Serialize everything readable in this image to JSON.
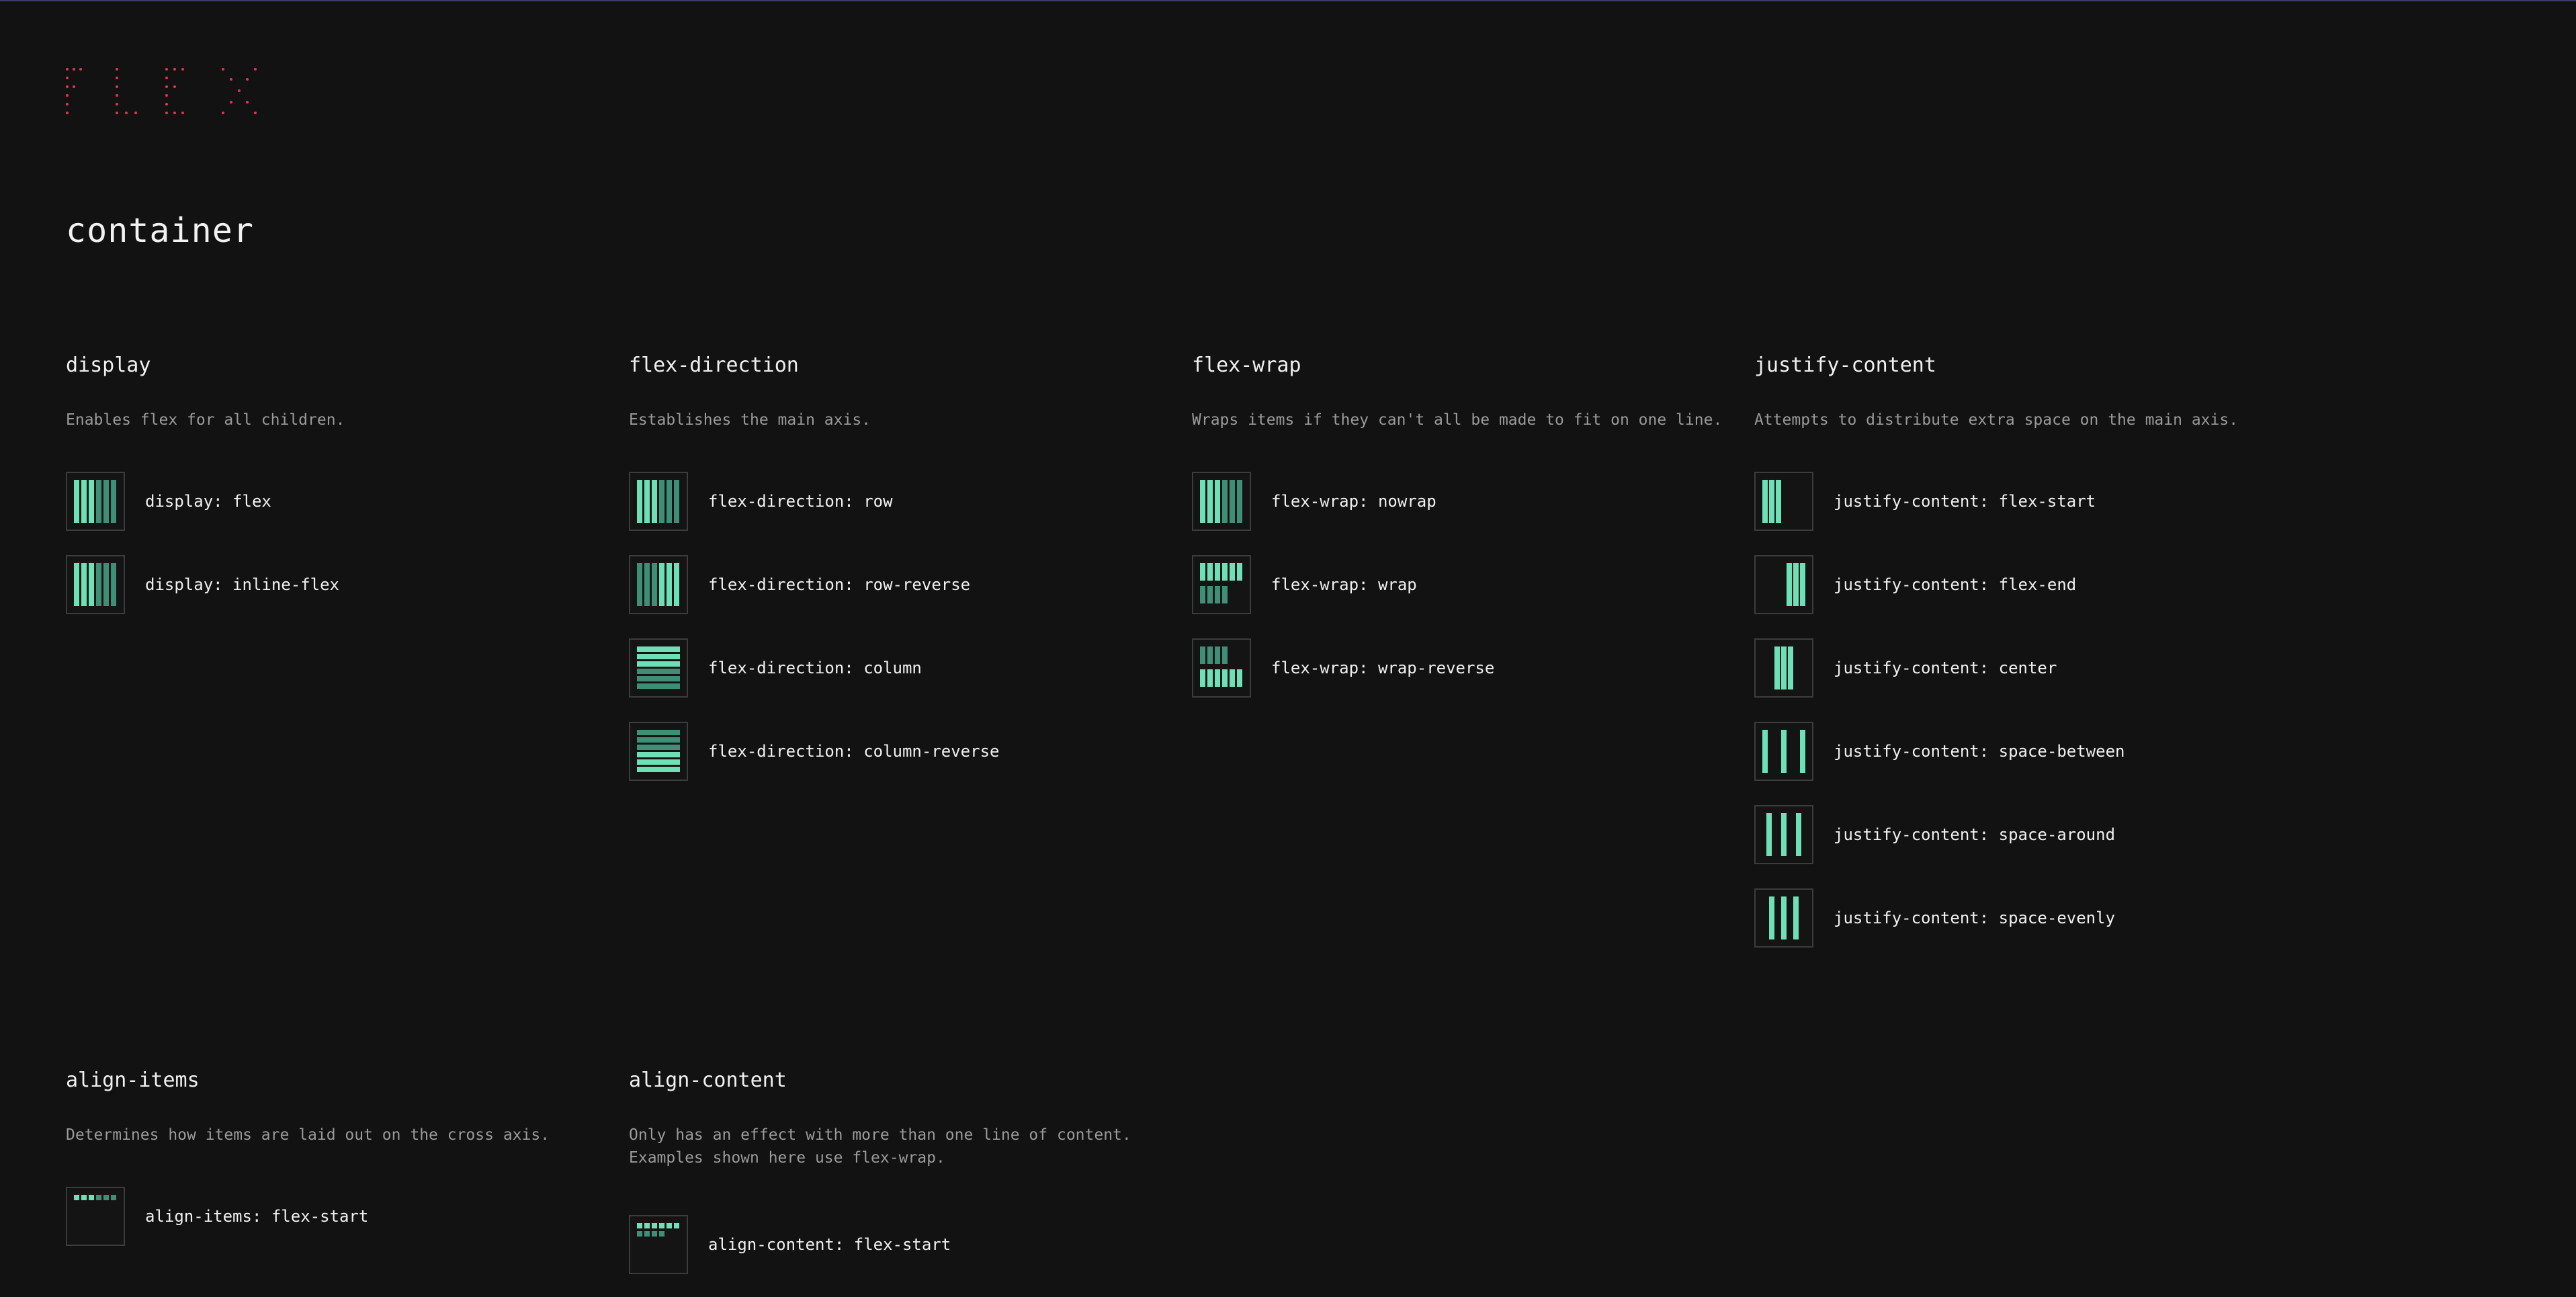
{
  "logo": {
    "text": "FLEX",
    "color": "#e2344f"
  },
  "colors": {
    "accent_light": "#6ee0b8",
    "accent_dark": "#3f8f76",
    "background": "#121212"
  },
  "heading": "container",
  "sections": {
    "display": {
      "title": "display",
      "description": "Enables flex for all children.",
      "items": [
        "display: flex",
        "display: inline-flex"
      ]
    },
    "flex_direction": {
      "title": "flex-direction",
      "description": "Establishes the main axis.",
      "items": [
        "flex-direction: row",
        "flex-direction: row-reverse",
        "flex-direction: column",
        "flex-direction: column-reverse"
      ]
    },
    "flex_wrap": {
      "title": "flex-wrap",
      "description": "Wraps items if they can't all be made to fit on one line.",
      "items": [
        "flex-wrap: nowrap",
        "flex-wrap: wrap",
        "flex-wrap: wrap-reverse"
      ]
    },
    "justify_content": {
      "title": "justify-content",
      "description": "Attempts to distribute extra space on the main axis.",
      "items": [
        "justify-content: flex-start",
        "justify-content: flex-end",
        "justify-content: center",
        "justify-content: space-between",
        "justify-content: space-around",
        "justify-content: space-evenly"
      ]
    },
    "align_items": {
      "title": "align-items",
      "description": "Determines how items are laid out on the cross axis.",
      "items": [
        "align-items: flex-start"
      ]
    },
    "align_content": {
      "title": "align-content",
      "description": "Only has an effect with more than one line of content.\nExamples shown here use flex-wrap.",
      "items": [
        "align-content: flex-start"
      ]
    }
  }
}
